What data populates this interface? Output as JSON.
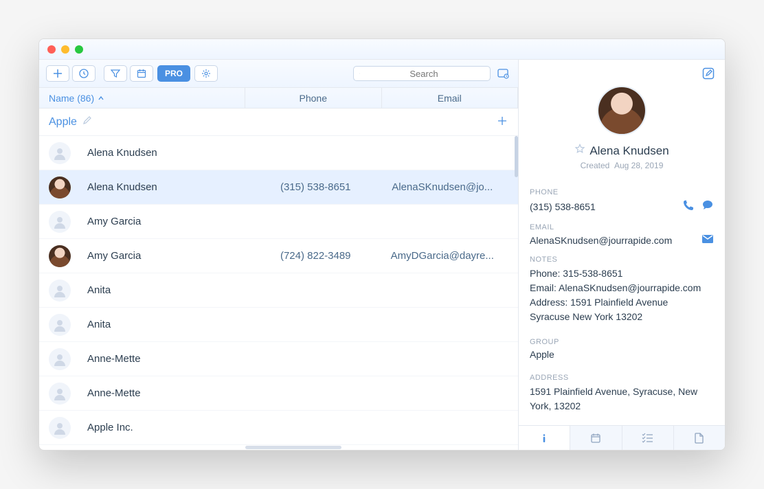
{
  "toolbar": {
    "pro_label": "PRO",
    "search_placeholder": "Search"
  },
  "columns": {
    "name_label": "Name  (86)",
    "phone_label": "Phone",
    "email_label": "Email"
  },
  "group": {
    "title": "Apple"
  },
  "contacts": [
    {
      "name": "Alena Knudsen",
      "phone": "",
      "email": "",
      "photo": false,
      "selected": false
    },
    {
      "name": "Alena Knudsen",
      "phone": "(315) 538-8651",
      "email": "AlenaSKnudsen@jo...",
      "photo": true,
      "selected": true
    },
    {
      "name": "Amy Garcia",
      "phone": "",
      "email": "",
      "photo": false,
      "selected": false
    },
    {
      "name": "Amy Garcia",
      "phone": "(724) 822-3489",
      "email": "AmyDGarcia@dayre...",
      "photo": true,
      "selected": false
    },
    {
      "name": "Anita",
      "phone": "",
      "email": "",
      "photo": false,
      "selected": false
    },
    {
      "name": "Anita",
      "phone": "",
      "email": "",
      "photo": false,
      "selected": false
    },
    {
      "name": "Anne-Mette",
      "phone": "",
      "email": "",
      "photo": false,
      "selected": false
    },
    {
      "name": "Anne-Mette",
      "phone": "",
      "email": "",
      "photo": false,
      "selected": false
    },
    {
      "name": "Apple Inc.",
      "phone": "",
      "email": "",
      "photo": false,
      "selected": false
    }
  ],
  "detail": {
    "name": "Alena Knudsen",
    "created_label": "Created",
    "created_date": "Aug 28, 2019",
    "phone_label": "PHONE",
    "phone": "(315) 538-8651",
    "email_label": "EMAIL",
    "email": "AlenaSKnudsen@jourrapide.com",
    "notes_label": "NOTES",
    "notes": "Phone: 315-538-8651\nEmail: AlenaSKnudsen@jourrapide.com\nAddress: 1591 Plainfield Avenue\nSyracuse New York 13202",
    "group_label": "GROUP",
    "group": "Apple",
    "address_label": "ADDRESS",
    "address": "1591 Plainfield Avenue, Syracuse, New York, 13202"
  }
}
